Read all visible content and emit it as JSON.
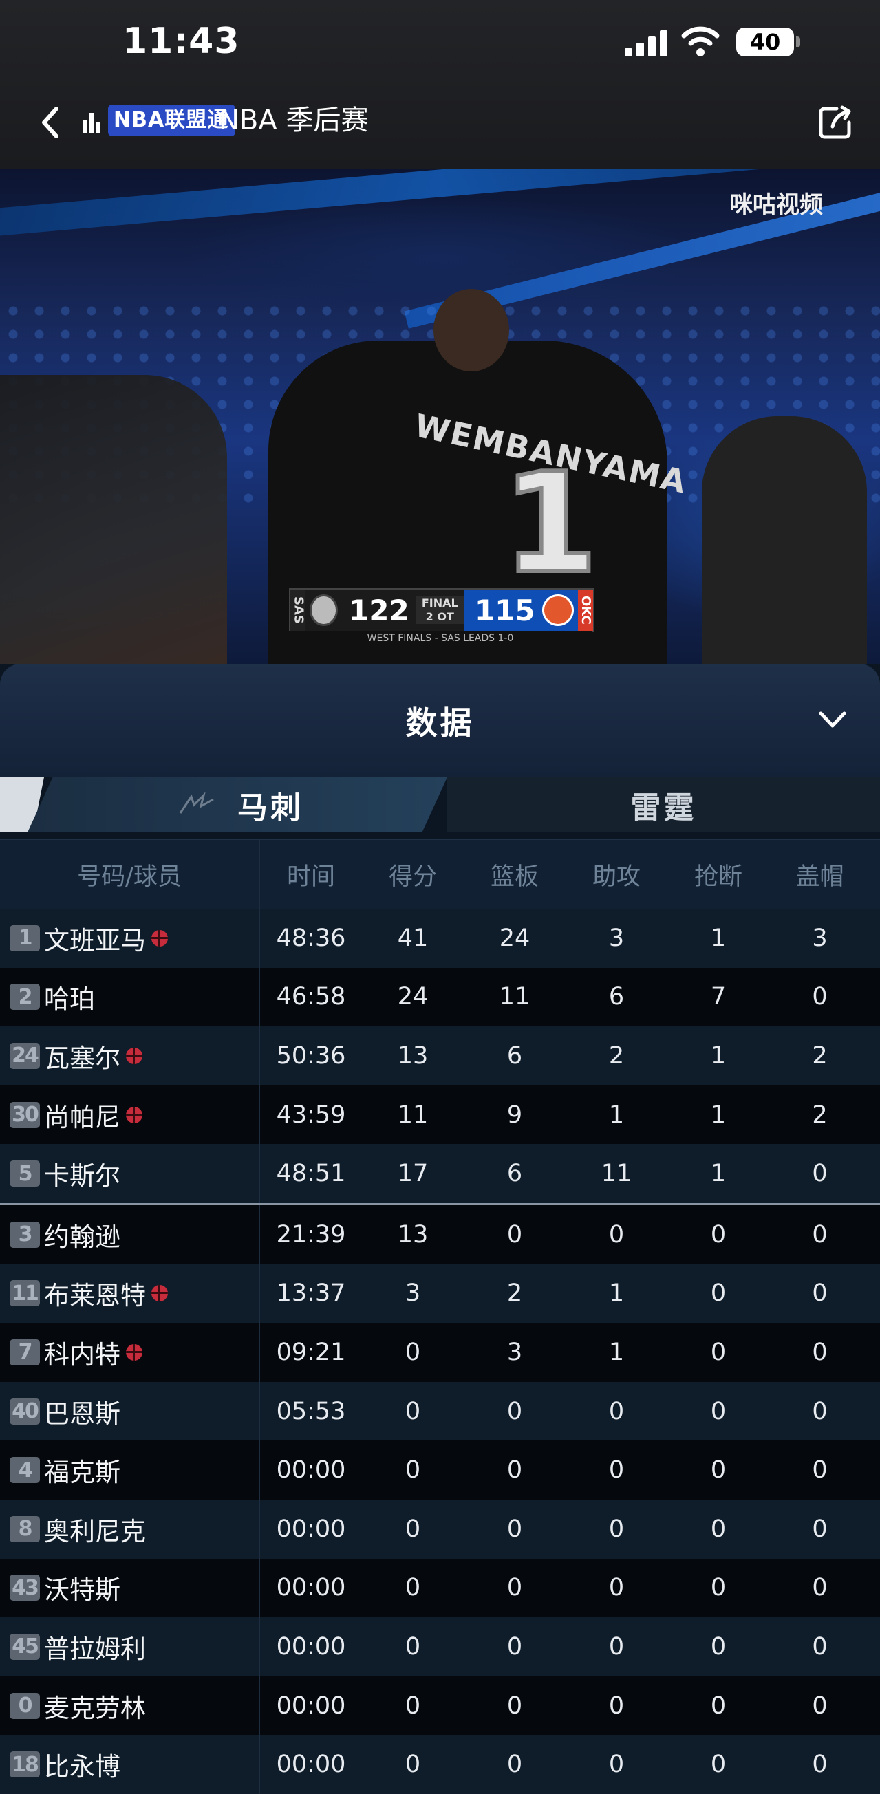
{
  "status_bar": {
    "time": "11:43",
    "battery": "40"
  },
  "top_nav": {
    "brand_label": "NBA联盟通",
    "title": "NBA 季后赛"
  },
  "video": {
    "watermark": "咪咕视频",
    "jersey_name": "WEMBANYAMA",
    "jersey_number": "1",
    "scorebug": {
      "away_abbr": "SAS",
      "away_score": "122",
      "status_line1": "FINAL",
      "status_line2": "2 OT",
      "home_score": "115",
      "home_abbr": "OKC",
      "footer": "WEST FINALS - SAS LEADS 1-0"
    }
  },
  "panel": {
    "title": "数据",
    "tabs": [
      {
        "label": "马刺",
        "active": true
      },
      {
        "label": "雷霆",
        "active": false
      }
    ],
    "columns": [
      "号码/球员",
      "时间",
      "得分",
      "篮板",
      "助攻",
      "抢断",
      "盖帽"
    ],
    "rows": [
      {
        "num": "1",
        "name": "文班亚马",
        "mark": true,
        "min": "48:36",
        "pts": "41",
        "reb": "24",
        "ast": "3",
        "stl": "1",
        "blk": "3"
      },
      {
        "num": "2",
        "name": "哈珀",
        "mark": false,
        "min": "46:58",
        "pts": "24",
        "reb": "11",
        "ast": "6",
        "stl": "7",
        "blk": "0"
      },
      {
        "num": "24",
        "name": "瓦塞尔",
        "mark": true,
        "min": "50:36",
        "pts": "13",
        "reb": "6",
        "ast": "2",
        "stl": "1",
        "blk": "2"
      },
      {
        "num": "30",
        "name": "尚帕尼",
        "mark": true,
        "min": "43:59",
        "pts": "11",
        "reb": "9",
        "ast": "1",
        "stl": "1",
        "blk": "2"
      },
      {
        "num": "5",
        "name": "卡斯尔",
        "mark": false,
        "min": "48:51",
        "pts": "17",
        "reb": "6",
        "ast": "11",
        "stl": "1",
        "blk": "0"
      },
      {
        "num": "3",
        "name": "约翰逊",
        "mark": false,
        "min": "21:39",
        "pts": "13",
        "reb": "0",
        "ast": "0",
        "stl": "0",
        "blk": "0"
      },
      {
        "num": "11",
        "name": "布莱恩特",
        "mark": true,
        "min": "13:37",
        "pts": "3",
        "reb": "2",
        "ast": "1",
        "stl": "0",
        "blk": "0"
      },
      {
        "num": "7",
        "name": "科内特",
        "mark": true,
        "min": "09:21",
        "pts": "0",
        "reb": "3",
        "ast": "1",
        "stl": "0",
        "blk": "0"
      },
      {
        "num": "40",
        "name": "巴恩斯",
        "mark": false,
        "min": "05:53",
        "pts": "0",
        "reb": "0",
        "ast": "0",
        "stl": "0",
        "blk": "0"
      },
      {
        "num": "4",
        "name": "福克斯",
        "mark": false,
        "min": "00:00",
        "pts": "0",
        "reb": "0",
        "ast": "0",
        "stl": "0",
        "blk": "0"
      },
      {
        "num": "8",
        "name": "奥利尼克",
        "mark": false,
        "min": "00:00",
        "pts": "0",
        "reb": "0",
        "ast": "0",
        "stl": "0",
        "blk": "0"
      },
      {
        "num": "43",
        "name": "沃特斯",
        "mark": false,
        "min": "00:00",
        "pts": "0",
        "reb": "0",
        "ast": "0",
        "stl": "0",
        "blk": "0"
      },
      {
        "num": "45",
        "name": "普拉姆利",
        "mark": false,
        "min": "00:00",
        "pts": "0",
        "reb": "0",
        "ast": "0",
        "stl": "0",
        "blk": "0"
      },
      {
        "num": "0",
        "name": "麦克劳林",
        "mark": false,
        "min": "00:00",
        "pts": "0",
        "reb": "0",
        "ast": "0",
        "stl": "0",
        "blk": "0"
      },
      {
        "num": "18",
        "name": "比永博",
        "mark": false,
        "min": "00:00",
        "pts": "0",
        "reb": "0",
        "ast": "0",
        "stl": "0",
        "blk": "0"
      }
    ]
  }
}
